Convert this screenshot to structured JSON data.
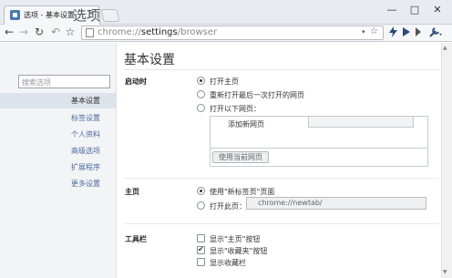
{
  "window": {
    "tab_title": "选项 - 基本设置",
    "tab_close": "×",
    "min": "—",
    "max": "□",
    "close": "✕"
  },
  "toolbar": {
    "back": "←",
    "forward": "→",
    "reload": "↻",
    "undo": "↶",
    "star": "☆",
    "url_scheme": "chrome://",
    "url_host": "settings",
    "url_path": "/browser",
    "dropdown": "▾"
  },
  "sidebar": {
    "title": "选项",
    "search_placeholder": "搜索选项",
    "items": [
      {
        "label": "基本设置"
      },
      {
        "label": "标签设置"
      },
      {
        "label": "个人资料"
      },
      {
        "label": "高级选项"
      },
      {
        "label": "扩展程序"
      },
      {
        "label": "更多设置"
      }
    ]
  },
  "main": {
    "title": "基本设置",
    "startup": {
      "label": "启动时",
      "options": [
        "打开主页",
        "重新打开最后一次打开的网页",
        "打开以下网页："
      ],
      "selected": 0,
      "add_page_label": "添加新网页",
      "use_current_button": "使用当前网页"
    },
    "homepage": {
      "label": "主页",
      "options": [
        "使用\"新标签页\"页面",
        "打开此页："
      ],
      "selected": 0,
      "url_value": "chrome://newtab/"
    },
    "toolbar_section": {
      "label": "工具栏",
      "checks": [
        {
          "label": "显示\"主页\"按钮",
          "checked": false
        },
        {
          "label": "显示\"收藏夹\"按钮",
          "checked": true
        },
        {
          "label": "显示收藏栏",
          "checked": false
        }
      ]
    }
  },
  "colors": {
    "sidebar_link": "#4b6a9e",
    "sidebar_selected_bg": "#dde3ea",
    "accent": "#4a78b8"
  }
}
